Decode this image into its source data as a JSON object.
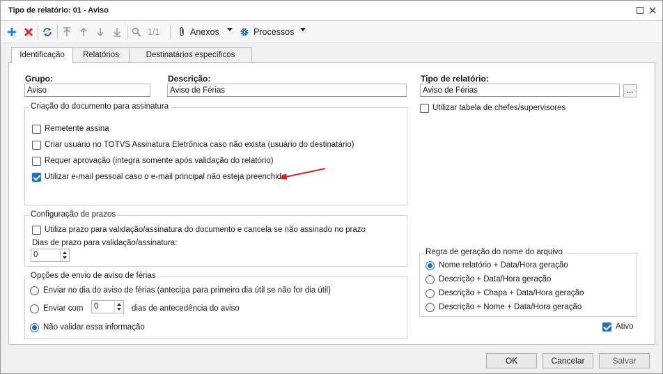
{
  "window": {
    "title": "Tipo de relatório: 01 - Aviso"
  },
  "toolbar": {
    "page_indicator": "1/1",
    "anexos_label": "Anexos",
    "processos_label": "Processos"
  },
  "tabs": [
    {
      "label": "Identificação",
      "active": true
    },
    {
      "label": "Relatórios",
      "active": false
    },
    {
      "label": "Destinatários específicos",
      "active": false
    }
  ],
  "form": {
    "grupo": {
      "label": "Grupo:",
      "value": "Aviso"
    },
    "descricao": {
      "label": "Descrição:",
      "value": "Aviso de Férias"
    },
    "tipo_relatorio": {
      "label": "Tipo de relatório:",
      "value": "Aviso de Férias",
      "browse": "..."
    },
    "utilizar_tabela_chefes": {
      "label": "Utilizar tabela de chefes/supervisores",
      "checked": false
    }
  },
  "criacao_documento": {
    "title": "Criação do documento para assinatura",
    "options": [
      {
        "label": "Remetente assina",
        "checked": false
      },
      {
        "label": "Criar usuário no TOTVS Assinatura Eletrônica caso não exista (usuário do destinatário)",
        "checked": false
      },
      {
        "label": "Requer aprovação (integra somente após validação do relatório)",
        "checked": false
      },
      {
        "label": "Utilizar e-mail pessoal caso o e-mail principal não esteja preenchido",
        "checked": true
      }
    ]
  },
  "configuracao_prazos": {
    "title": "Configuração de prazos",
    "utiliza_prazo": {
      "label": "Utiliza prazo para validação/assinatura do documento e cancela se não assinado no prazo",
      "checked": false
    },
    "dias_label": "Dias de prazo para validação/assinatura:",
    "dias_value": "0"
  },
  "opcoes_envio": {
    "title": "Opções de envio de aviso de férias",
    "enviar_no_dia": {
      "label": "Enviar no dia do aviso de férias (antecipa para primeiro dia útil se não for dia útil)",
      "checked": false
    },
    "enviar_com": {
      "label": "Enviar com",
      "value": "0",
      "suffix": "dias de antecedência do aviso",
      "checked": false
    },
    "nao_validar": {
      "label": "Não validar essa informação",
      "checked": true
    }
  },
  "regra_nome_arquivo": {
    "title": "Regra de geração do nome do arquivo",
    "options": [
      {
        "label": "Nome relatório + Data/Hora geração",
        "checked": true
      },
      {
        "label": "Descrição + Data/Hora geração",
        "checked": false
      },
      {
        "label": "Descrição + Chapa + Data/Hora geração",
        "checked": false
      },
      {
        "label": "Descrição + Nome + Data/Hora geração",
        "checked": false
      }
    ]
  },
  "ativo": {
    "label": "Ativo",
    "checked": true
  },
  "buttons": {
    "ok": "OK",
    "cancelar": "Cancelar",
    "salvar": "Salvar"
  },
  "colors": {
    "accent": "#1c6fd0",
    "add_icon": "#1e88e5",
    "delete_icon": "#d32f2f",
    "annotation_arrow": "#e02020"
  }
}
